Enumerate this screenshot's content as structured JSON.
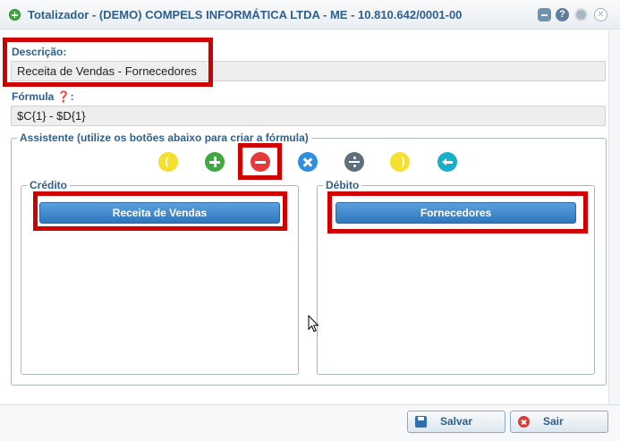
{
  "window": {
    "title": "Totalizador - (DEMO) COMPELS INFORMÁTICA LTDA - ME - 10.810.642/0001-00",
    "help_glyph": "?",
    "close_glyph": "✕"
  },
  "form": {
    "descricao_label": "Descrição:",
    "descricao_value": "Receita de Vendas - Fornecedores",
    "formula_label": "Fórmula ❓:",
    "formula_value": "$C{1} - $D{1}"
  },
  "assistente": {
    "legend": "Assistente (utilize os botões abaixo para criar a fórmula)",
    "operators": [
      "open-paren",
      "plus",
      "minus",
      "times",
      "divide",
      "close-paren",
      "backspace"
    ]
  },
  "credito": {
    "legend": "Crédito",
    "items": [
      "Receita de Vendas"
    ]
  },
  "debito": {
    "legend": "Débito",
    "items": [
      "Fornecedores"
    ]
  },
  "footer": {
    "save_label": "Salvar",
    "exit_label": "Sair"
  },
  "colors": {
    "highlight": "#d00000",
    "accent": "#2f5f8c",
    "button_blue": "#2f76bd"
  }
}
